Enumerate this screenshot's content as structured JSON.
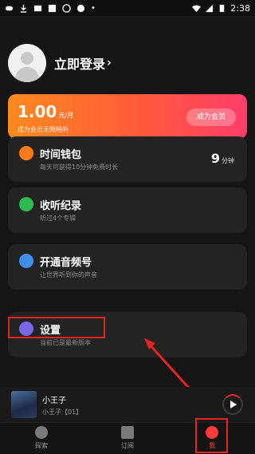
{
  "status": {
    "time": "2:38"
  },
  "profile": {
    "login_label": "立即登录",
    "chevron": "›"
  },
  "vip": {
    "price": "1.00",
    "unit": "元/月",
    "subtitle": "成为会员无限畅听",
    "button": "成为会员"
  },
  "menu": [
    {
      "title": "时间钱包",
      "desc": "每天可获得10分钟免费时长",
      "value": "9",
      "unit": "分钟",
      "icon": "wallet-icon"
    },
    {
      "title": "收听纪录",
      "desc": "听过4个专辑",
      "icon": "history-icon"
    },
    {
      "title": "开通音频号",
      "desc": "让世界听到你的声音",
      "icon": "channel-icon"
    },
    {
      "title": "设置",
      "desc": "当前已是最新版本",
      "icon": "settings-icon"
    }
  ],
  "player": {
    "title": "小王子",
    "subtitle": "小王子【01】"
  },
  "nav": {
    "explore": "探索",
    "subscribe": "订阅",
    "me": "我"
  },
  "colors": {
    "accent": "#ff3a3a",
    "annotation": "#e8231f"
  }
}
